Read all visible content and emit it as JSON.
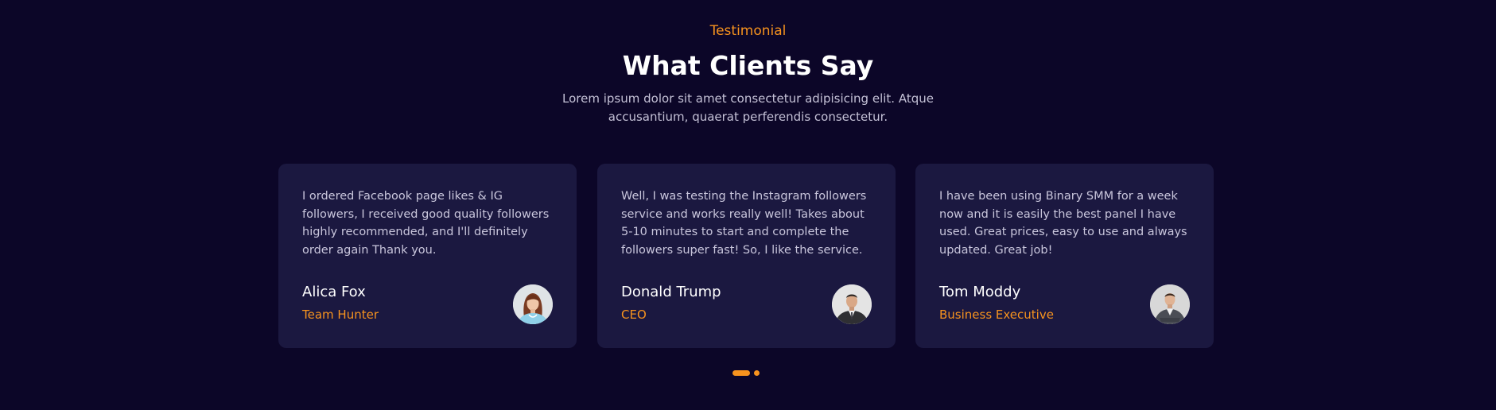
{
  "section": {
    "eyebrow": "Testimonial",
    "title": "What Clients Say",
    "subtitle": "Lorem ipsum dolor sit amet consectetur adipisicing elit. Atque accusantium, quaerat perferendis consectetur."
  },
  "testimonials": [
    {
      "quote": "I ordered Facebook page likes & IG followers, I received good quality followers highly recommended, and I'll definitely order again Thank you.",
      "name": "Alica Fox",
      "role": "Team Hunter"
    },
    {
      "quote": "Well, I was testing the Instagram followers service and works really well! Takes about 5-10 minutes to start and complete the followers super fast! So, I like the service.",
      "name": "Donald Trump",
      "role": "CEO"
    },
    {
      "quote": "I have been using Binary SMM for a week now and it is easily the best panel I have used. Great prices, easy to use and always updated. Great job!",
      "name": "Tom Moddy",
      "role": "Business Executive"
    }
  ],
  "carousel": {
    "slide_count": 2,
    "active_index": 0
  },
  "colors": {
    "background": "#0c0628",
    "card": "#1b1840",
    "accent": "#f7931e",
    "heading": "#ffffff",
    "body_text": "#c9c6dc"
  }
}
